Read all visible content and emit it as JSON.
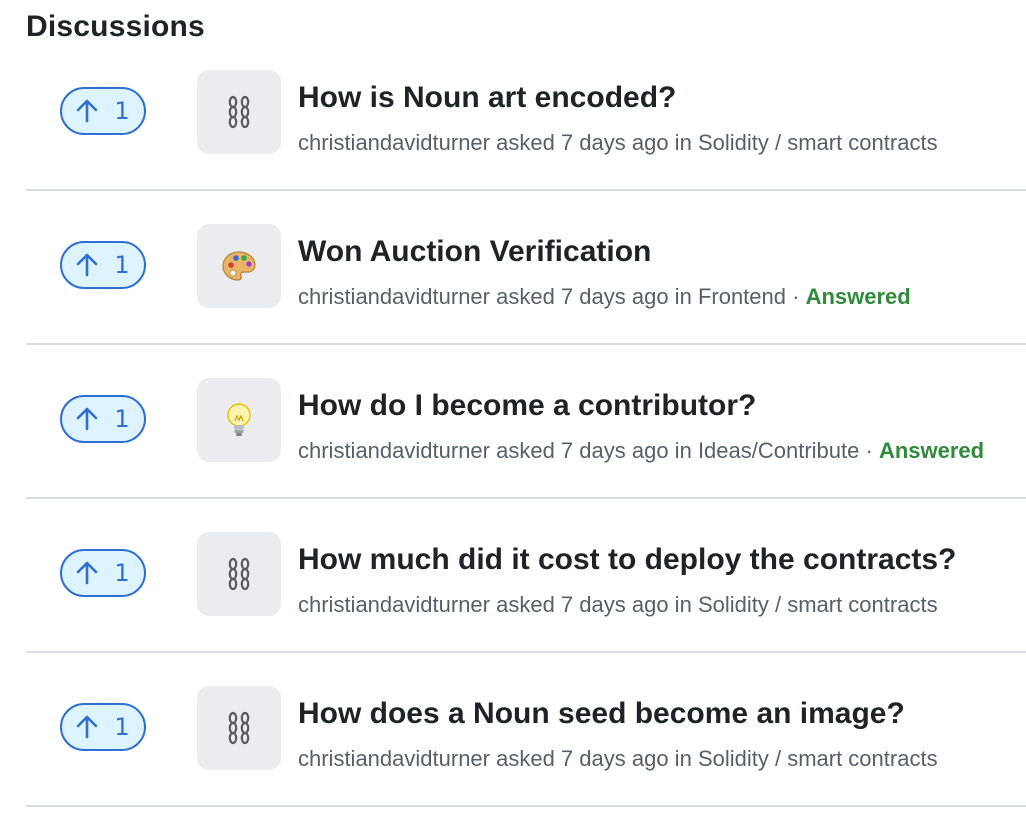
{
  "section": {
    "title": "Discussions"
  },
  "discussions": [
    {
      "title": "How is Noun art encoded?",
      "author": "christiandavidturner",
      "asked": "asked 7 days ago in",
      "category": "Solidity / smart contracts",
      "category_icon": "chains-icon",
      "votes": "1",
      "answered": ""
    },
    {
      "title": "Won Auction Verification",
      "author": "christiandavidturner",
      "asked": "asked 7 days ago in",
      "category": "Frontend",
      "category_icon": "palette-icon",
      "votes": "1",
      "answered": "Answered"
    },
    {
      "title": "How do I become a contributor?",
      "author": "christiandavidturner",
      "asked": "asked 7 days ago in",
      "category": "Ideas/Contribute",
      "category_icon": "lightbulb-icon",
      "votes": "1",
      "answered": "Answered"
    },
    {
      "title": "How much did it cost to deploy the contracts?",
      "author": "christiandavidturner",
      "asked": "asked 7 days ago in",
      "category": "Solidity / smart contracts",
      "category_icon": "chains-icon",
      "votes": "1",
      "answered": ""
    },
    {
      "title": "How does a Noun seed become an image?",
      "author": "christiandavidturner",
      "asked": "asked 7 days ago in",
      "category": "Solidity / smart contracts",
      "category_icon": "chains-icon",
      "votes": "1",
      "answered": ""
    }
  ],
  "colors": {
    "accent": "#2f6fd1",
    "upvote_bg": "#ddf4ff",
    "answered": "#2f8a3b",
    "muted_text": "#57606a",
    "divider": "#d8dee4"
  }
}
